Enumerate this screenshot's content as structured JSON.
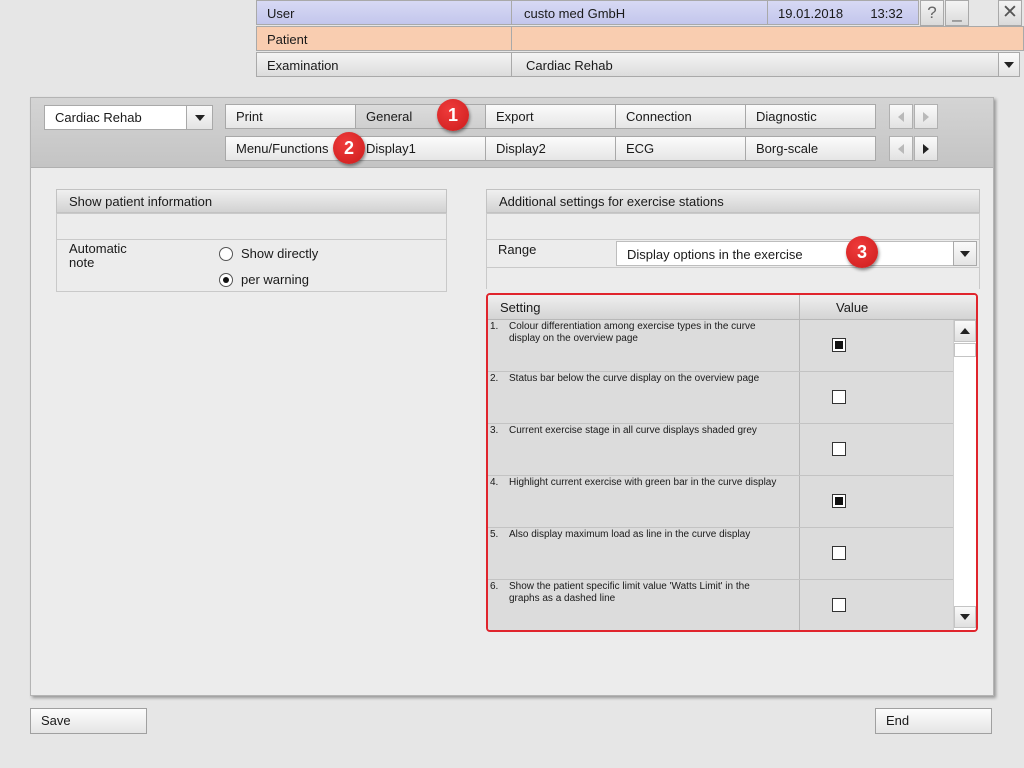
{
  "header": {
    "user_label": "User",
    "user_value": "custo med GmbH",
    "date": "19.01.2018",
    "time": "13:32",
    "help_glyph": "?",
    "minimize_glyph": "_",
    "close_glyph": "✕",
    "patient_label": "Patient",
    "patient_value": "",
    "examination_label": "Examination",
    "examination_value": "Cardiac Rehab",
    "colors": {
      "user_bg": "#c9ccef",
      "patient_bg": "#f9cdb0"
    }
  },
  "toolbar": {
    "mode_select": "Cardiac Rehab",
    "tabs_row1": [
      "Print",
      "General",
      "Export",
      "Connection",
      "Diagnostic"
    ],
    "tabs_row2": [
      "Menu/Functions",
      "Display1",
      "Display2",
      "ECG",
      "Borg-scale"
    ],
    "active_tab": "General",
    "icons": {
      "prev": "chevron-left-icon",
      "next": "chevron-right-icon"
    }
  },
  "callouts": [
    "1",
    "2",
    "3"
  ],
  "left_group": {
    "title": "Show patient information",
    "field_label": "Automatic note",
    "field_label_line1": "Automatic",
    "field_label_line2": "note",
    "options": [
      "Show directly",
      "per warning"
    ],
    "selected": "per warning"
  },
  "right_group": {
    "title": "Additional settings for exercise stations",
    "range_label": "Range",
    "range_value": "Display options in the exercise",
    "table": {
      "col_setting": "Setting",
      "col_value": "Value",
      "rows": [
        {
          "num": "1.",
          "text": "Colour differentiation among exercise types in the curve display on the overview page",
          "checked": true
        },
        {
          "num": "2.",
          "text": "Status bar below the curve display on the overview page",
          "checked": false
        },
        {
          "num": "3.",
          "text": "Current exercise stage in all curve displays shaded grey",
          "checked": false
        },
        {
          "num": "4.",
          "text": "Highlight current exercise with green bar in the curve display",
          "checked": true
        },
        {
          "num": "5.",
          "text": "Also display maximum load as line in the curve display",
          "checked": false
        },
        {
          "num": "6.",
          "text": "Show the patient specific limit value 'Watts Limit' in the graphs as a dashed line",
          "checked": false
        }
      ]
    }
  },
  "footer": {
    "save_label": "Save",
    "end_label": "End"
  }
}
